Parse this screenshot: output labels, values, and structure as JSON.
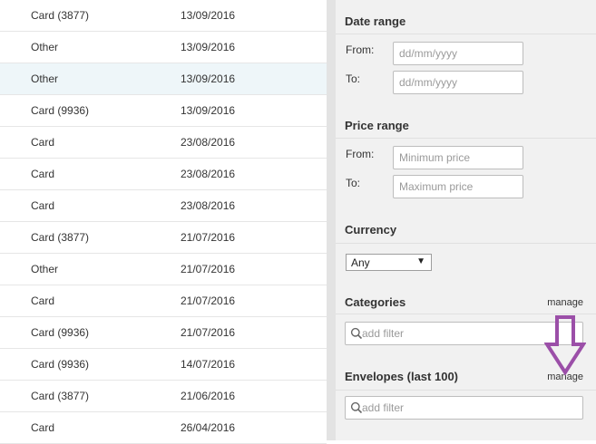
{
  "transactions": [
    {
      "method": "Card (3877)",
      "date": "13/09/2016"
    },
    {
      "method": "Other",
      "date": "13/09/2016"
    },
    {
      "method": "Other",
      "date": "13/09/2016",
      "highlighted": true
    },
    {
      "method": "Card (9936)",
      "date": "13/09/2016"
    },
    {
      "method": "Card",
      "date": "23/08/2016"
    },
    {
      "method": "Card",
      "date": "23/08/2016"
    },
    {
      "method": "Card",
      "date": "23/08/2016"
    },
    {
      "method": "Card (3877)",
      "date": "21/07/2016"
    },
    {
      "method": "Other",
      "date": "21/07/2016"
    },
    {
      "method": "Card",
      "date": "21/07/2016"
    },
    {
      "method": "Card (9936)",
      "date": "21/07/2016"
    },
    {
      "method": "Card (9936)",
      "date": "14/07/2016"
    },
    {
      "method": "Card (3877)",
      "date": "21/06/2016"
    },
    {
      "method": "Card",
      "date": "26/04/2016"
    }
  ],
  "filters": {
    "date_range": {
      "title": "Date range",
      "from_label": "From:",
      "to_label": "To:",
      "from_placeholder": "dd/mm/yyyy",
      "to_placeholder": "dd/mm/yyyy"
    },
    "price_range": {
      "title": "Price range",
      "from_label": "From:",
      "to_label": "To:",
      "from_placeholder": "Minimum price",
      "to_placeholder": "Maximum price"
    },
    "currency": {
      "title": "Currency",
      "selected": "Any"
    },
    "categories": {
      "title": "Categories",
      "manage_label": "manage",
      "search_placeholder": "add filter"
    },
    "envelopes": {
      "title": "Envelopes (last 100)",
      "manage_label": "manage",
      "search_placeholder": "add filter"
    }
  },
  "colors": {
    "panel_bg": "#f1f1f1",
    "row_highlight": "#eef6f9",
    "annotation_arrow": "#9b4fa8"
  },
  "icons": [
    "search-icon",
    "dropdown-caret-icon",
    "down-arrow-annotation"
  ]
}
